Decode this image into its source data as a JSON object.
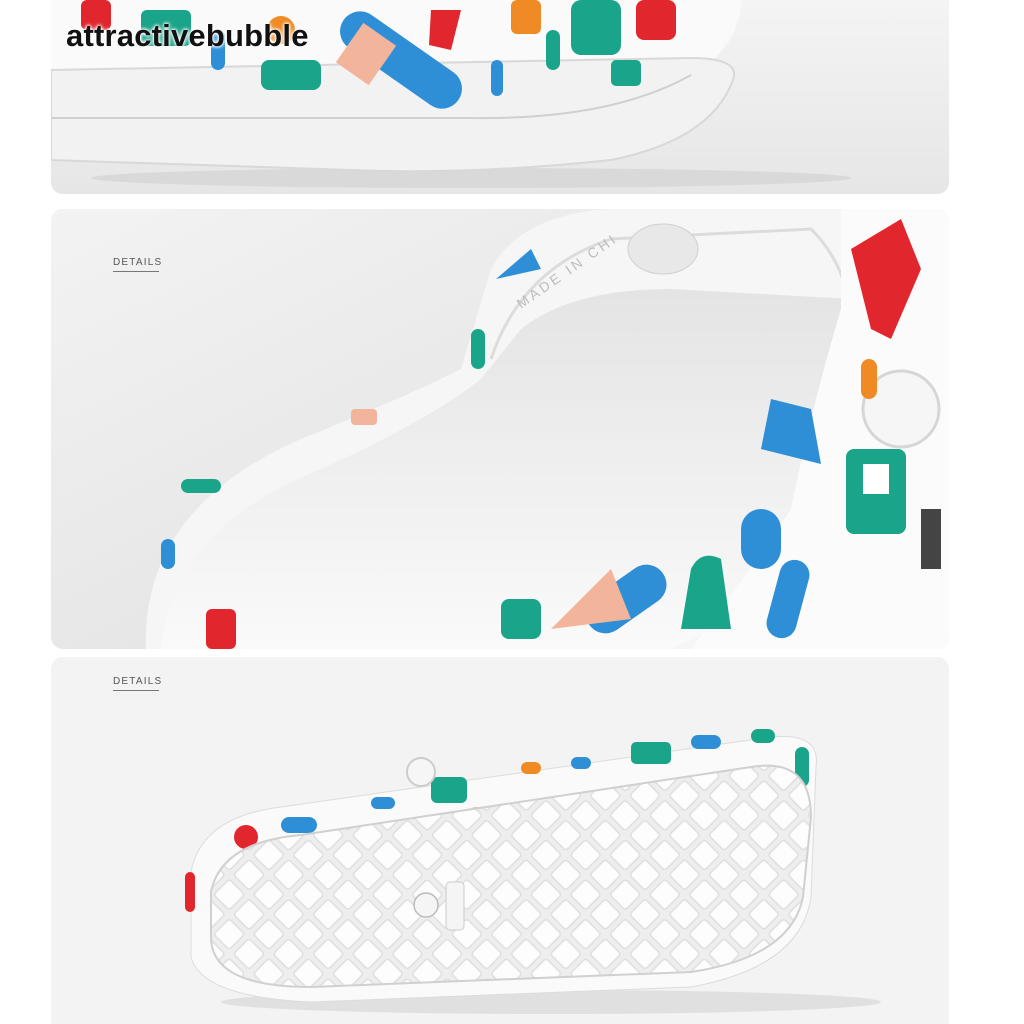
{
  "watermark": "attractivebubble",
  "panels": [
    {
      "id": "top",
      "description_label": ""
    },
    {
      "id": "middle",
      "details_label": "DETAILS",
      "emboss_text": "MADE IN CHI"
    },
    {
      "id": "bottom",
      "details_label": "DETAILS"
    }
  ],
  "colors": {
    "sole": "#ffffff",
    "background": "#efefef",
    "accent_red": "#e2262e",
    "accent_teal": "#1aa48a",
    "accent_blue": "#2f8fd6",
    "accent_orange": "#f08a24"
  }
}
